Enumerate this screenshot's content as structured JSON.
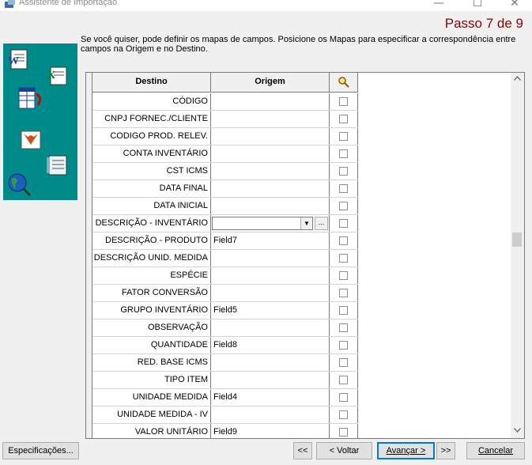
{
  "window": {
    "title": "Assistente de Importação",
    "minimize_icon": "minimize-icon",
    "maximize_icon": "maximize-icon",
    "close_icon": "close-icon"
  },
  "step": "Passo 7 de 9",
  "instructions": "Se você quiser, pode definir os mapas de campos. Posicione os Mapas para especificar a correspondência entre campos na Origem e no Destino.",
  "grid": {
    "headers": {
      "destino": "Destino",
      "origem": "Origem",
      "search_icon": "magnifier-icon"
    },
    "rows": [
      {
        "destino": "CÓDIGO",
        "origem": ""
      },
      {
        "destino": "CNPJ FORNEC./CLIENTE",
        "origem": ""
      },
      {
        "destino": "CODIGO PROD. RELEV.",
        "origem": ""
      },
      {
        "destino": "CONTA INVENTÁRIO",
        "origem": ""
      },
      {
        "destino": "CST ICMS",
        "origem": ""
      },
      {
        "destino": "DATA FINAL",
        "origem": ""
      },
      {
        "destino": "DATA INICIAL",
        "origem": ""
      },
      {
        "destino": "DESCRIÇÃO - INVENTÁRIO",
        "origem": "",
        "editing": true
      },
      {
        "destino": "DESCRIÇÃO - PRODUTO",
        "origem": "Field7"
      },
      {
        "destino": "DESCRIÇÃO UNID. MEDIDA",
        "origem": ""
      },
      {
        "destino": "ESPÉCIE",
        "origem": ""
      },
      {
        "destino": "FATOR CONVERSÃO",
        "origem": ""
      },
      {
        "destino": "GRUPO INVENTÁRIO",
        "origem": "Field5"
      },
      {
        "destino": "OBSERVAÇÃO",
        "origem": ""
      },
      {
        "destino": "QUANTIDADE",
        "origem": "Field8"
      },
      {
        "destino": "RED. BASE ICMS",
        "origem": ""
      },
      {
        "destino": "TIPO ITEM",
        "origem": ""
      },
      {
        "destino": "UNIDADE MEDIDA",
        "origem": "Field4"
      },
      {
        "destino": "UNIDADE MEDIDA - IV",
        "origem": ""
      },
      {
        "destino": "VALOR UNITÁRIO",
        "origem": "Field9"
      }
    ],
    "combo_dropdown_glyph": "▼",
    "ellipsis_label": "...",
    "scroll_up_glyph": "^",
    "scroll_down_glyph": "v",
    "scroll_position": 0.45
  },
  "buttons": {
    "specs": "Especificações...",
    "first": "<<",
    "back": "< Voltar",
    "next": "Avançar >",
    "last": ">>",
    "cancel": "Cancelar"
  },
  "colors": {
    "step": "#7a0a0a",
    "left_panel": "#008b8b",
    "default_button_border": "#0078d7"
  }
}
